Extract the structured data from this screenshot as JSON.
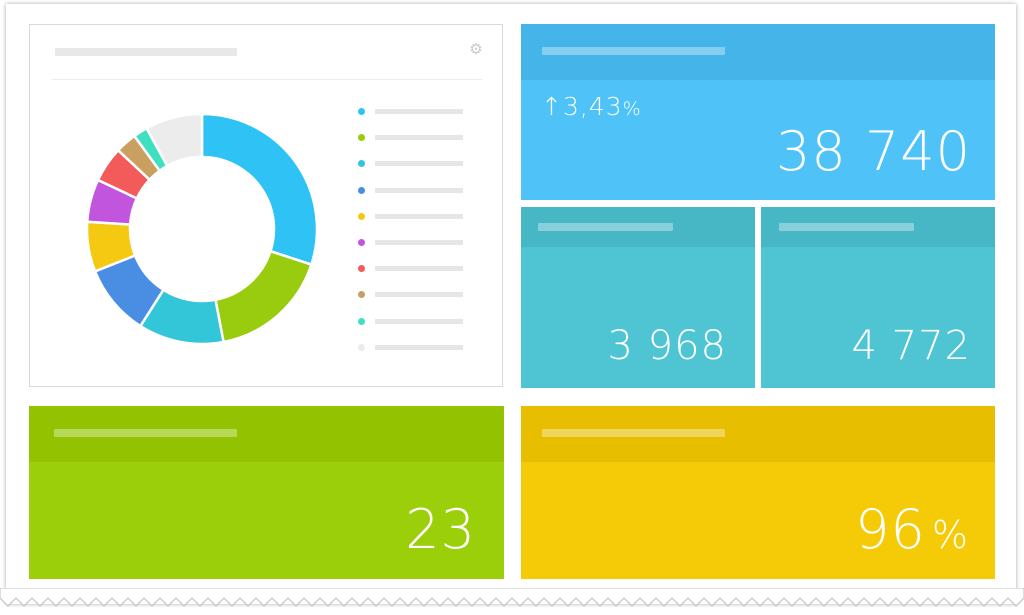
{
  "colors": {
    "blue": "#4fc3f7",
    "teal": "#4fc5d4",
    "green": "#9bcf0a",
    "yellow": "#f5cb08"
  },
  "chart_card": {
    "settings_icon": "gear-icon"
  },
  "chart_data": {
    "type": "pie",
    "values": [
      30,
      17,
      12,
      10,
      7,
      6,
      5,
      3,
      2,
      8
    ],
    "colors": [
      "#2ec3f4",
      "#99cc0f",
      "#32c6d8",
      "#4a8ee3",
      "#f5c812",
      "#c155de",
      "#f35a5a",
      "#c9a060",
      "#3fe0c2",
      "#ececec"
    ]
  },
  "kpi_main": {
    "change": "↑3,43",
    "change_unit": "%",
    "value": "38 740"
  },
  "kpi_left": {
    "value": "3 968"
  },
  "kpi_right": {
    "value": "4 772"
  },
  "kpi_count": {
    "value": "23"
  },
  "kpi_percent": {
    "value": "96",
    "unit": "%"
  }
}
